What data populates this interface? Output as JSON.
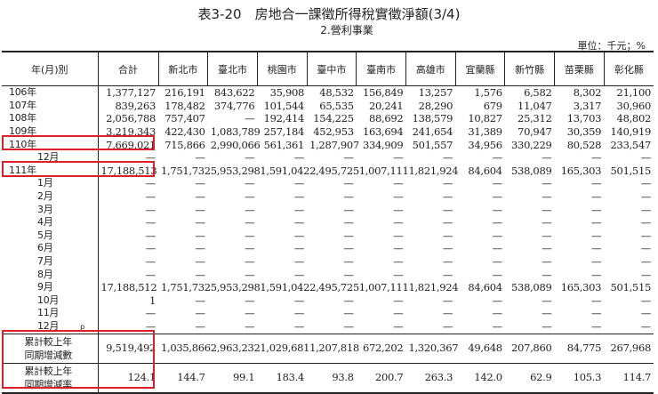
{
  "title": "表3-20　房地合一課徵所得稅實徵淨額(3/4)",
  "subtitle": "2.營利事業",
  "unit": "單位：千元；%",
  "headers": [
    "年(月)別",
    "合計",
    "新北市",
    "臺北市",
    "桃園市",
    "臺中市",
    "臺南市",
    "高雄市",
    "宜蘭縣",
    "新竹縣",
    "苗栗縣",
    "彰化縣"
  ],
  "rows": [
    {
      "label": "106年",
      "values": [
        "1,377,127",
        "216,191",
        "843,622",
        "35,908",
        "48,532",
        "156,849",
        "13,257",
        "1,576",
        "6,582",
        "8,302",
        "21,100"
      ]
    },
    {
      "label": "107年",
      "values": [
        "839,263",
        "178,482",
        "374,776",
        "101,544",
        "65,535",
        "20,241",
        "28,290",
        "679",
        "11,047",
        "3,317",
        "30,960"
      ]
    },
    {
      "label": "108年",
      "values": [
        "2,056,788",
        "757,407",
        "—",
        "192,414",
        "154,225",
        "88,692",
        "138,579",
        "10,827",
        "25,312",
        "13,703",
        "48,802"
      ]
    },
    {
      "label": "109年",
      "values": [
        "3,219,343",
        "422,430",
        "1,083,789",
        "257,184",
        "452,953",
        "163,694",
        "241,654",
        "31,389",
        "70,947",
        "30,359",
        "140,919"
      ]
    },
    {
      "label": "110年",
      "values": [
        "7,669,021",
        "715,866",
        "2,990,066",
        "561,361",
        "1,287,907",
        "334,909",
        "501,557",
        "34,956",
        "330,229",
        "80,528",
        "233,547"
      ]
    },
    {
      "label": "12月",
      "month": true,
      "values": [
        "—",
        "—",
        "—",
        "—",
        "—",
        "—",
        "—",
        "—",
        "—",
        "—",
        "—"
      ]
    },
    {
      "label": "111年",
      "values": [
        "17,188,513",
        "1,751,732",
        "5,953,298",
        "1,591,042",
        "2,495,725",
        "1,007,111",
        "1,821,924",
        "84,604",
        "538,089",
        "165,303",
        "501,515"
      ]
    },
    {
      "label": "1月",
      "month": true,
      "values": [
        "—",
        "—",
        "—",
        "—",
        "—",
        "—",
        "—",
        "—",
        "—",
        "—",
        "—"
      ]
    },
    {
      "label": "2月",
      "month": true,
      "values": [
        "—",
        "—",
        "—",
        "—",
        "—",
        "—",
        "—",
        "—",
        "—",
        "—",
        "—"
      ]
    },
    {
      "label": "3月",
      "month": true,
      "values": [
        "—",
        "—",
        "—",
        "—",
        "—",
        "—",
        "—",
        "—",
        "—",
        "—",
        "—"
      ]
    },
    {
      "label": "4月",
      "month": true,
      "values": [
        "—",
        "—",
        "—",
        "—",
        "—",
        "—",
        "—",
        "—",
        "—",
        "—",
        "—"
      ]
    },
    {
      "label": "5月",
      "month": true,
      "values": [
        "—",
        "—",
        "—",
        "—",
        "—",
        "—",
        "—",
        "—",
        "—",
        "—",
        "—"
      ]
    },
    {
      "label": "6月",
      "month": true,
      "values": [
        "—",
        "—",
        "—",
        "—",
        "—",
        "—",
        "—",
        "—",
        "—",
        "—",
        "—"
      ]
    },
    {
      "label": "7月",
      "month": true,
      "values": [
        "—",
        "—",
        "—",
        "—",
        "—",
        "—",
        "—",
        "—",
        "—",
        "—",
        "—"
      ]
    },
    {
      "label": "8月",
      "month": true,
      "values": [
        "—",
        "—",
        "—",
        "—",
        "—",
        "—",
        "—",
        "—",
        "—",
        "—",
        "—"
      ]
    },
    {
      "label": "9月",
      "month": true,
      "values": [
        "17,188,512",
        "1,751,732",
        "5,953,298",
        "1,591,042",
        "2,495,725",
        "1,007,111",
        "1,821,924",
        "84,604",
        "538,089",
        "165,303",
        "501,515"
      ]
    },
    {
      "label": "10月",
      "month": true,
      "values": [
        "1",
        "—",
        "—",
        "—",
        "—",
        "—",
        "—",
        "—",
        "—",
        "—",
        "—"
      ]
    },
    {
      "label": "11月",
      "month": true,
      "values": [
        "—",
        "—",
        "—",
        "—",
        "—",
        "—",
        "—",
        "—",
        "—",
        "—",
        "—"
      ]
    },
    {
      "label": "12月",
      "month": true,
      "note": "p",
      "values": [
        "—",
        "—",
        "—",
        "—",
        "—",
        "—",
        "—",
        "—",
        "—",
        "—",
        "—"
      ]
    }
  ],
  "summary": [
    {
      "label_line1": "累計較上年",
      "label_line2": "同期增減數",
      "values": [
        "9,519,492",
        "1,035,866",
        "2,963,232",
        "1,029,681",
        "1,207,818",
        "672,202",
        "1,320,367",
        "49,648",
        "207,860",
        "84,775",
        "267,968"
      ]
    },
    {
      "label_line1": "累計較上年",
      "label_line2": "同期增減率",
      "values": [
        "124.1",
        "144.7",
        "99.1",
        "183.4",
        "93.8",
        "200.7",
        "263.3",
        "142.0",
        "62.9",
        "105.3",
        "114.7"
      ]
    }
  ],
  "highlight_color": "#d8212a"
}
